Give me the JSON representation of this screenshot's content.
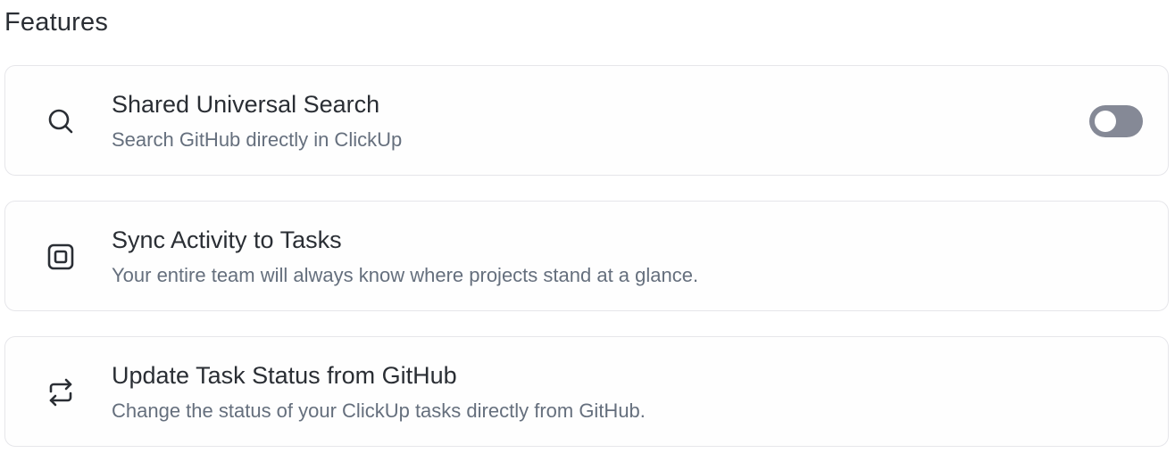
{
  "section": {
    "title": "Features"
  },
  "features": [
    {
      "icon": "search-icon",
      "title": "Shared Universal Search",
      "description": "Search GitHub directly in ClickUp",
      "toggle": {
        "enabled": false
      }
    },
    {
      "icon": "sync-square-icon",
      "title": "Sync Activity to Tasks",
      "description": "Your entire team will always know where projects stand at a glance."
    },
    {
      "icon": "repeat-arrows-icon",
      "title": "Update Task Status from GitHub",
      "description": "Change the status of your ClickUp tasks directly from GitHub."
    }
  ],
  "colors": {
    "toggle_off": "#858996",
    "card_border": "#e6e6ea",
    "title_text": "#2a2e34",
    "description_text": "#656f7d"
  }
}
